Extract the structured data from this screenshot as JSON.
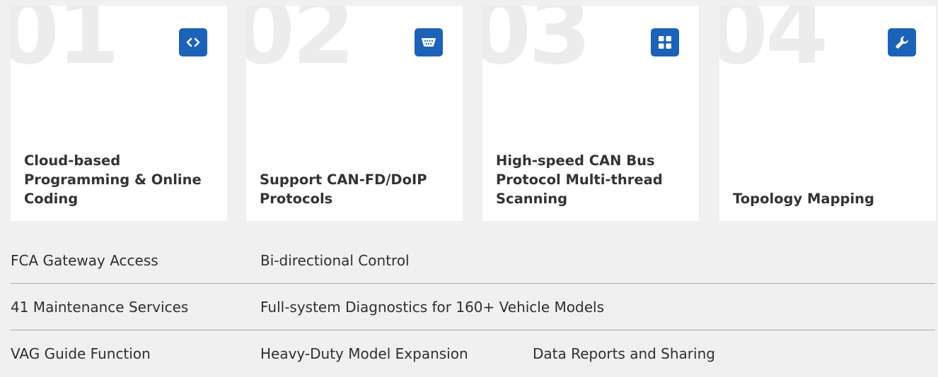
{
  "cards": [
    {
      "number": "01",
      "icon": "code-icon",
      "title": "Cloud-based Programming & Online Coding"
    },
    {
      "number": "02",
      "icon": "port-connector-icon",
      "title": "Support CAN-FD/DoIP Protocols"
    },
    {
      "number": "03",
      "icon": "grid-icon",
      "title": "High-speed CAN Bus Protocol Multi-thread Scanning"
    },
    {
      "number": "04",
      "icon": "wrench-icon",
      "title": "Topology Mapping"
    }
  ],
  "features": {
    "rows": [
      [
        "FCA Gateway Access",
        "Bi-directional Control",
        ""
      ],
      [
        "41 Maintenance Services",
        "Full-system Diagnostics for 160+ Vehicle Models",
        ""
      ],
      [
        "VAG Guide Function",
        "Heavy-Duty Model Expansion",
        "Data Reports and Sharing"
      ]
    ]
  },
  "colors": {
    "accent": "#1c62b9",
    "background": "#f0f0f0",
    "card": "#ffffff",
    "divider": "#a9a9a9"
  }
}
